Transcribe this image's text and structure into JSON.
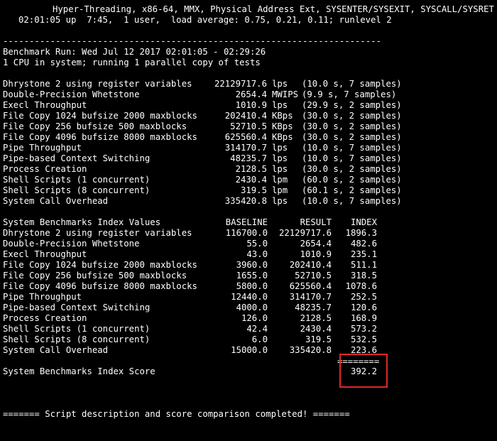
{
  "header": {
    "cpu_flags": "Hyper-Threading, x86-64, MMX, Physical Address Ext, SYSENTER/SYSEXIT, SYSCALL/SYSRET",
    "uptime": "02:01:05 up  7:45,  1 user,  load average: 0.75, 0.21, 0.11; runlevel 2"
  },
  "separator": "------------------------------------------------------------------------",
  "run": {
    "title": "Benchmark Run: Wed Jul 12 2017 02:01:05 - 02:29:26",
    "cpus": "1 CPU in system; running 1 parallel copy of tests"
  },
  "raw_results": [
    {
      "name": "Dhrystone 2 using register variables",
      "value": "22129717.6",
      "unit": "lps",
      "detail": "(10.0 s, 7 samples)"
    },
    {
      "name": "Double-Precision Whetstone",
      "value": "2654.4",
      "unit": "MWIPS",
      "detail": "(9.9 s, 7 samples)"
    },
    {
      "name": "Execl Throughput",
      "value": "1010.9",
      "unit": "lps",
      "detail": "(29.9 s, 2 samples)"
    },
    {
      "name": "File Copy 1024 bufsize 2000 maxblocks",
      "value": "202410.4",
      "unit": "KBps",
      "detail": "(30.0 s, 2 samples)"
    },
    {
      "name": "File Copy 256 bufsize 500 maxblocks",
      "value": "52710.5",
      "unit": "KBps",
      "detail": "(30.0 s, 2 samples)"
    },
    {
      "name": "File Copy 4096 bufsize 8000 maxblocks",
      "value": "625560.4",
      "unit": "KBps",
      "detail": "(30.0 s, 2 samples)"
    },
    {
      "name": "Pipe Throughput",
      "value": "314170.7",
      "unit": "lps",
      "detail": "(10.0 s, 7 samples)"
    },
    {
      "name": "Pipe-based Context Switching",
      "value": "48235.7",
      "unit": "lps",
      "detail": "(10.0 s, 7 samples)"
    },
    {
      "name": "Process Creation",
      "value": "2128.5",
      "unit": "lps",
      "detail": "(30.0 s, 2 samples)"
    },
    {
      "name": "Shell Scripts (1 concurrent)",
      "value": "2430.4",
      "unit": "lpm",
      "detail": "(60.0 s, 2 samples)"
    },
    {
      "name": "Shell Scripts (8 concurrent)",
      "value": "319.5",
      "unit": "lpm",
      "detail": "(60.1 s, 2 samples)"
    },
    {
      "name": "System Call Overhead",
      "value": "335420.8",
      "unit": "lps",
      "detail": "(10.0 s, 7 samples)"
    }
  ],
  "index_table": {
    "title": "System Benchmarks Index Values",
    "col_baseline": "BASELINE",
    "col_result": "RESULT",
    "col_index": "INDEX",
    "rows": [
      {
        "name": "Dhrystone 2 using register variables",
        "baseline": "116700.0",
        "result": "22129717.6",
        "index": "1896.3"
      },
      {
        "name": "Double-Precision Whetstone",
        "baseline": "55.0",
        "result": "2654.4",
        "index": "482.6"
      },
      {
        "name": "Execl Throughput",
        "baseline": "43.0",
        "result": "1010.9",
        "index": "235.1"
      },
      {
        "name": "File Copy 1024 bufsize 2000 maxblocks",
        "baseline": "3960.0",
        "result": "202410.4",
        "index": "511.1"
      },
      {
        "name": "File Copy 256 bufsize 500 maxblocks",
        "baseline": "1655.0",
        "result": "52710.5",
        "index": "318.5"
      },
      {
        "name": "File Copy 4096 bufsize 8000 maxblocks",
        "baseline": "5800.0",
        "result": "625560.4",
        "index": "1078.6"
      },
      {
        "name": "Pipe Throughput",
        "baseline": "12440.0",
        "result": "314170.7",
        "index": "252.5"
      },
      {
        "name": "Pipe-based Context Switching",
        "baseline": "4000.0",
        "result": "48235.7",
        "index": "120.6"
      },
      {
        "name": "Process Creation",
        "baseline": "126.0",
        "result": "2128.5",
        "index": "168.9"
      },
      {
        "name": "Shell Scripts (1 concurrent)",
        "baseline": "42.4",
        "result": "2430.4",
        "index": "573.2"
      },
      {
        "name": "Shell Scripts (8 concurrent)",
        "baseline": "6.0",
        "result": "319.5",
        "index": "532.5"
      },
      {
        "name": "System Call Overhead",
        "baseline": "15000.0",
        "result": "335420.8",
        "index": "223.6"
      }
    ],
    "total_rule": "========",
    "score_label": "System Benchmarks Index Score",
    "score_value": "392.2"
  },
  "footer": "======= Script description and score comparison completed! =======",
  "colors": {
    "background": "#000000",
    "text": "#ffffff",
    "highlight_box": "#e0282a"
  }
}
